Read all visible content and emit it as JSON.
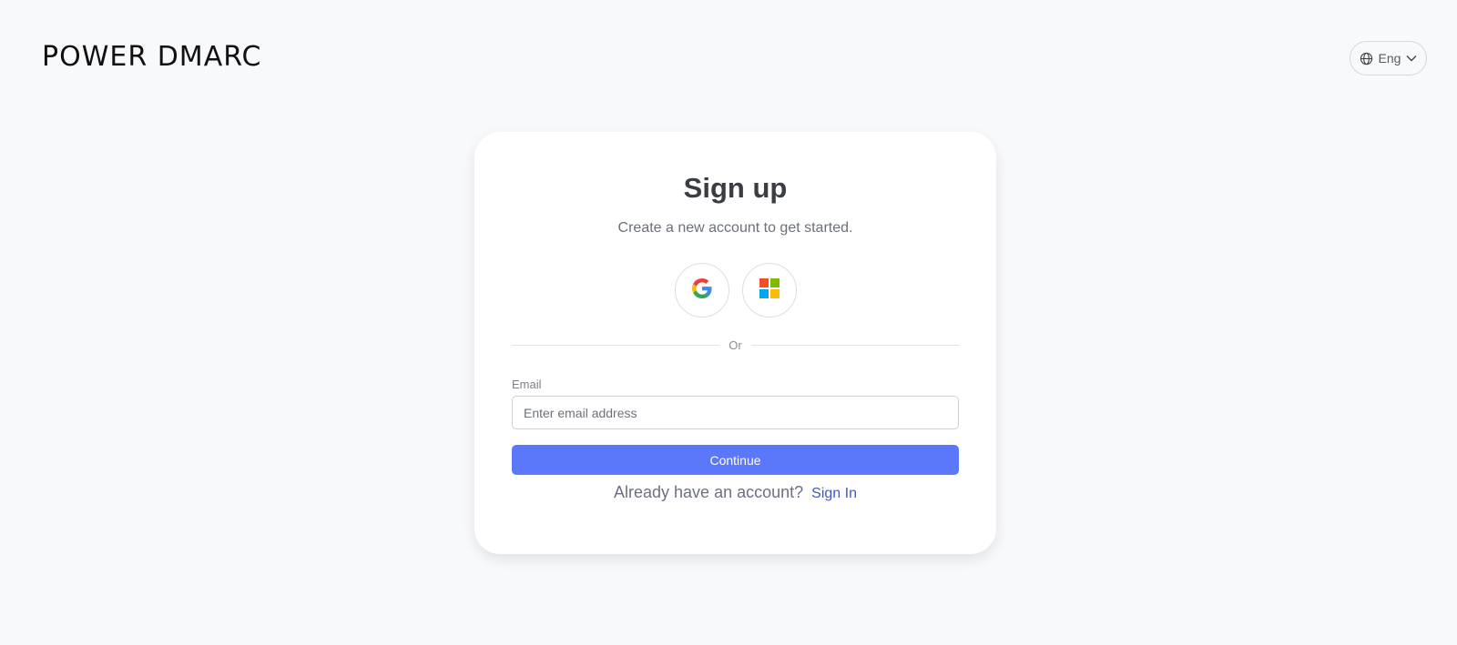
{
  "header": {
    "logo_text": "POWER DMARC",
    "language": {
      "label": "Eng",
      "icon": "globe-icon",
      "dropdown_icon": "chevron-down-icon"
    }
  },
  "signup": {
    "title": "Sign up",
    "subtitle": "Create a new account to get started.",
    "social_providers": [
      {
        "name": "google",
        "icon": "google-icon"
      },
      {
        "name": "microsoft",
        "icon": "microsoft-icon"
      }
    ],
    "divider_text": "Or",
    "email_label": "Email",
    "email_placeholder": "Enter email address",
    "email_value": "",
    "continue_label": "Continue",
    "signin_prompt": "Already have an account?",
    "signin_link": "Sign In"
  },
  "colors": {
    "background": "#f8f9fb",
    "primary": "#5b78fb",
    "link": "#3f57c9",
    "card": "#ffffff"
  }
}
